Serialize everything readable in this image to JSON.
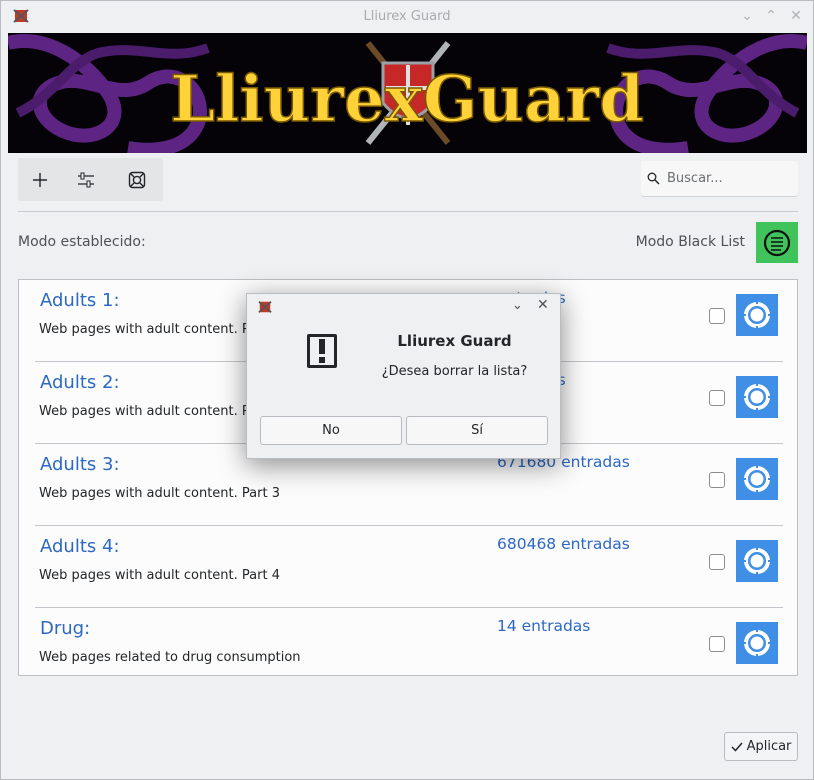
{
  "window": {
    "title": "Lliurex Guard",
    "controls": [
      "chevron-down-icon",
      "chevron-up-icon",
      "close-icon"
    ]
  },
  "banner": {
    "logo_text": "LliurexGuard"
  },
  "toolbar": {
    "buttons": [
      "add-icon",
      "sliders-icon",
      "lifebuoy-icon"
    ]
  },
  "search": {
    "placeholder": "Buscar..."
  },
  "mode": {
    "label": "Modo establecido:",
    "value": "Modo Black List",
    "color": "#3fc35a"
  },
  "lists": [
    {
      "name": "Adults 1:",
      "description": "Web pages with adult content. Part 1",
      "count": "entradas"
    },
    {
      "name": "Adults 2:",
      "description": "Web pages with adult content. Part 2",
      "count": "entradas"
    },
    {
      "name": "Adults 3:",
      "description": "Web pages with adult content. Part 3",
      "count": "671680 entradas"
    },
    {
      "name": "Adults 4:",
      "description": "Web pages with adult content. Part 4",
      "count": "680468 entradas"
    },
    {
      "name": "Drug:",
      "description": "Web pages related to drug consumption",
      "count": "14 entradas"
    }
  ],
  "apply": {
    "label": "Aplicar"
  },
  "dialog": {
    "title": "Lliurex Guard",
    "message": "¿Desea borrar la lista?",
    "no_label": "No",
    "yes_label": "Sí"
  },
  "colors": {
    "accent": "#2d68c4",
    "gear": "#3f8fe6",
    "banner_text": "#ffd23a"
  }
}
